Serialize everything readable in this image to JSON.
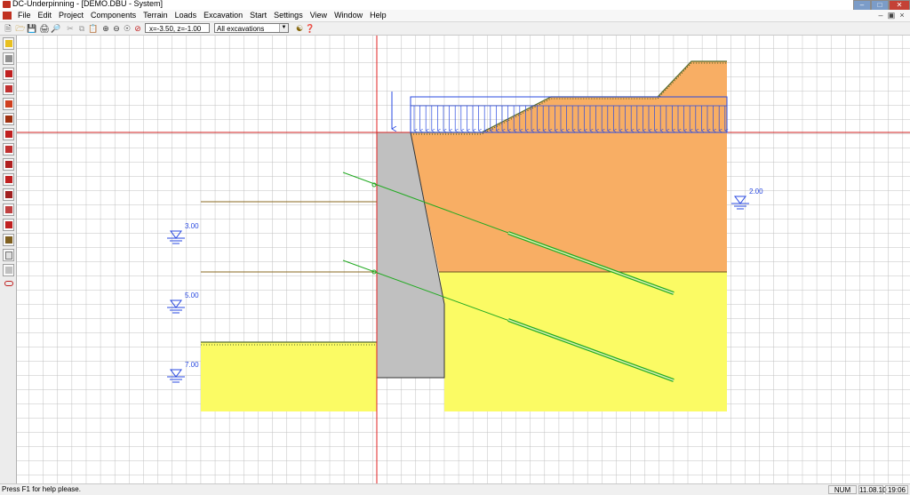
{
  "window": {
    "title": "DC-Underpinning - [DEMO.DBU - System]"
  },
  "menu": {
    "items": [
      "File",
      "Edit",
      "Project",
      "Components",
      "Terrain",
      "Loads",
      "Excavation",
      "Start",
      "Settings",
      "View",
      "Window",
      "Help"
    ]
  },
  "toolbar": {
    "coordinate_readout": "x=-3.50, z=-1.00",
    "excavation_select": "All excavations"
  },
  "sidebar": {
    "tools": [
      "soil-layers-icon",
      "ground-icon",
      "wall-icon",
      "wall-section-icon",
      "struts-icon",
      "anchors-icon",
      "terrain-icon",
      "load-icon",
      "graph-icon",
      "support-icon",
      "reinforcement-icon",
      "settlement-icon",
      "sigma-icon",
      "excavation-icon",
      "document-icon",
      "stamp-icon",
      "connector-icon"
    ]
  },
  "drawing": {
    "colors": {
      "clay": "#f8ae64",
      "sand": "#fbfb64",
      "wall": "#c0c0c0",
      "anchor": "#22aa22",
      "load": "#2a4ae0",
      "grid": "#c0c0c0",
      "axis_vertical": "#e02020",
      "axis_horizontal": "#d02020"
    },
    "water_levels": [
      {
        "label": "2.00",
        "side": "right"
      },
      {
        "label": "3.00",
        "side": "left"
      },
      {
        "label": "5.00",
        "side": "left"
      },
      {
        "label": "7.00",
        "side": "left"
      }
    ],
    "anchors": [
      {
        "name": "anchor-1"
      },
      {
        "name": "anchor-2"
      }
    ]
  },
  "status": {
    "help": "Press F1 for help please.",
    "num": "NUM",
    "date": "11.08.10",
    "time": "19:06"
  }
}
